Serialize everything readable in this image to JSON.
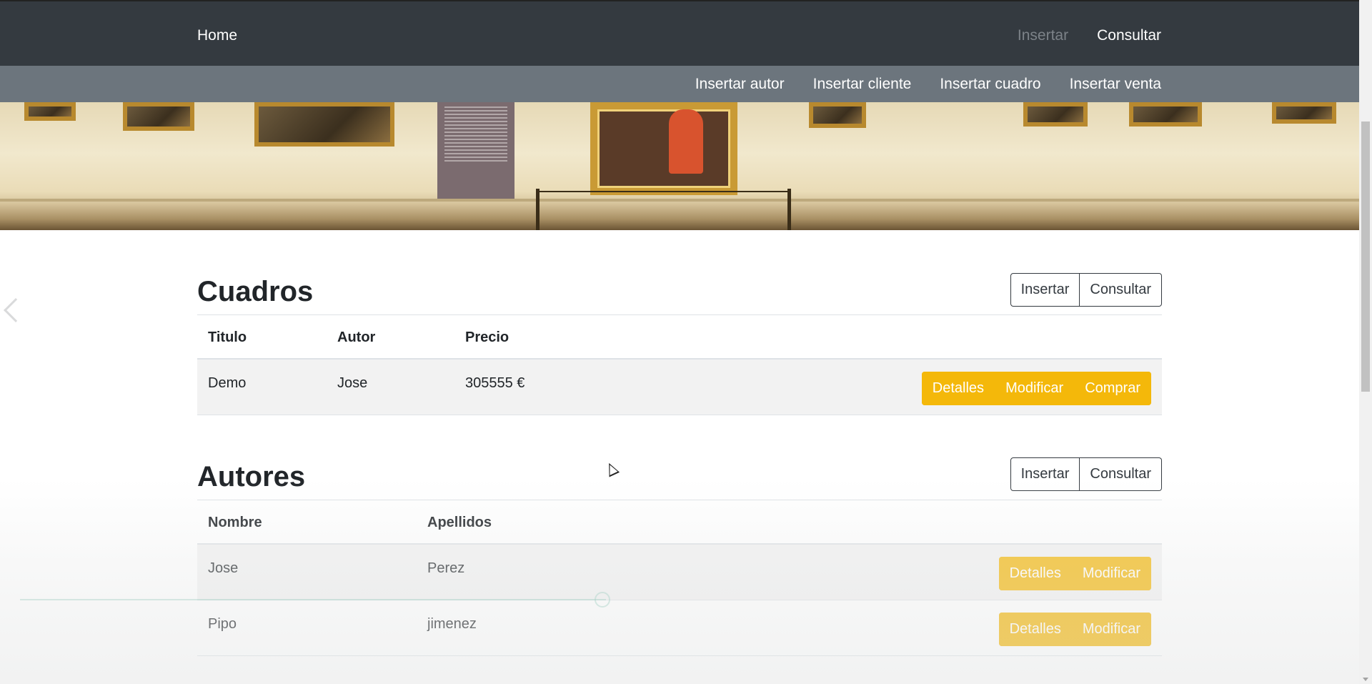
{
  "navbar": {
    "brand": "Home",
    "links": [
      {
        "label": "Insertar",
        "state": "muted"
      },
      {
        "label": "Consultar",
        "state": "active"
      }
    ]
  },
  "subnav": {
    "links": [
      "Insertar autor",
      "Insertar cliente",
      "Insertar cuadro",
      "Insertar venta"
    ]
  },
  "cuadros": {
    "title": "Cuadros",
    "insert_label": "Insertar",
    "consult_label": "Consultar",
    "columns": [
      "Titulo",
      "Autor",
      "Precio"
    ],
    "rows": [
      {
        "titulo": "Demo",
        "autor": "Jose",
        "precio": "305555 €",
        "actions": [
          "Detalles",
          "Modificar",
          "Comprar"
        ]
      }
    ]
  },
  "autores": {
    "title": "Autores",
    "insert_label": "Insertar",
    "consult_label": "Consultar",
    "columns": [
      "Nombre",
      "Apellidos"
    ],
    "rows": [
      {
        "nombre": "Jose",
        "apellidos": "Perez",
        "actions": [
          "Detalles",
          "Modificar"
        ]
      },
      {
        "nombre": "Pipo",
        "apellidos": "jimenez",
        "actions": [
          "Detalles",
          "Modificar"
        ]
      }
    ]
  },
  "colors": {
    "navbar_bg": "#343a40",
    "subnav_bg": "#6c757d",
    "action_button": "#f4b80a"
  },
  "icons": {
    "carousel_prev": "chevron-left-icon",
    "scroll_down": "chevron-down-icon"
  }
}
